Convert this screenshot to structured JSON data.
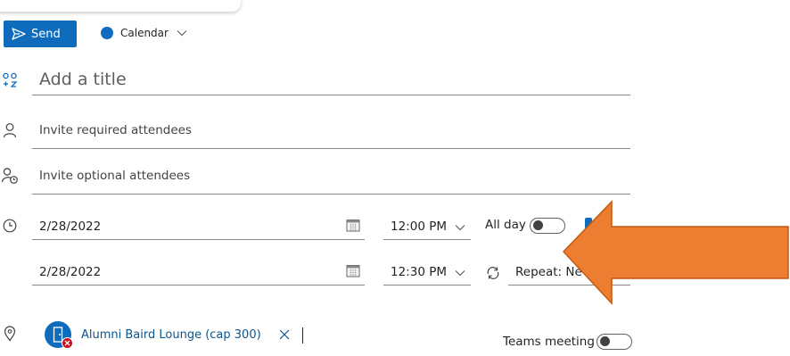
{
  "toolbar": {
    "send_label": "Send",
    "calendar_label": "Calendar"
  },
  "form": {
    "title_placeholder": "Add a title",
    "required_attendees_placeholder": "Invite required attendees",
    "optional_attendees_placeholder": "Invite optional attendees",
    "start_date": "2/28/2022",
    "start_time": "12:00 PM",
    "all_day_label": "All day",
    "all_day_enabled": false,
    "end_date": "2/28/2022",
    "end_time": "12:30 PM",
    "repeat_label": "Repeat: Ne",
    "location_chip": "Alumni Baird Lounge (cap 300)",
    "teams_meeting_label": "Teams meeting",
    "teams_meeting_enabled": false
  },
  "colors": {
    "accent": "#0f6cbd",
    "annotation_arrow": "#ed7d31",
    "error_badge": "#c50f1f"
  },
  "icons": [
    "send-icon",
    "calendar-dot-icon",
    "chevron-down-icon",
    "title-icon",
    "person-icon",
    "person-optional-icon",
    "clock-icon",
    "calendar-picker-icon",
    "repeat-icon",
    "location-pin-icon",
    "room-icon",
    "close-icon"
  ]
}
